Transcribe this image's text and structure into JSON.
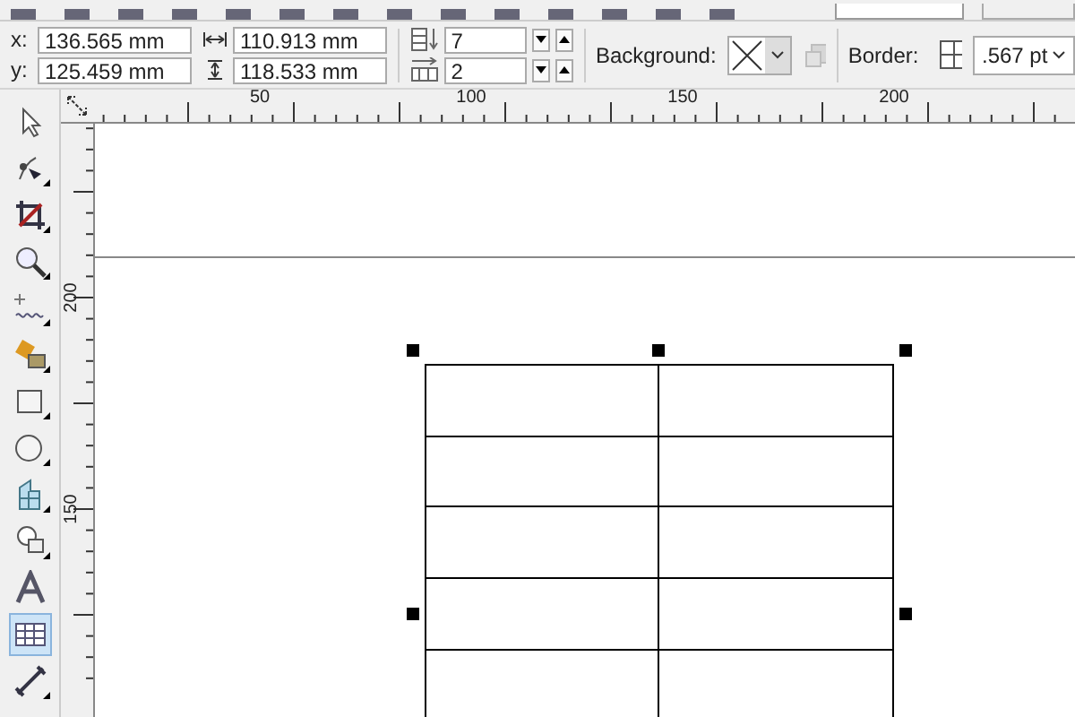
{
  "position": {
    "x_label": "x:",
    "x": "136.565 mm",
    "y_label": "y:",
    "y": "125.459 mm"
  },
  "size": {
    "width": "110.913 mm",
    "height": "118.533 mm"
  },
  "table_size": {
    "rows": "7",
    "columns": "2"
  },
  "background": {
    "label": "Background:"
  },
  "border": {
    "label": "Border:",
    "width": ".567 pt"
  },
  "ruler_h": {
    "labels": [
      "50",
      "100",
      "150",
      "200"
    ]
  },
  "ruler_v": {
    "labels": [
      "200",
      "150"
    ]
  },
  "tools": [
    {
      "kind": "pick",
      "selected": false
    },
    {
      "kind": "shape",
      "selected": false
    },
    {
      "kind": "crop",
      "selected": false
    },
    {
      "kind": "zoom",
      "selected": false
    },
    {
      "kind": "freehand",
      "selected": false
    },
    {
      "kind": "fill",
      "selected": false
    },
    {
      "kind": "rectangle",
      "selected": false
    },
    {
      "kind": "ellipse",
      "selected": false
    },
    {
      "kind": "object",
      "selected": false
    },
    {
      "kind": "shapes",
      "selected": false
    },
    {
      "kind": "text",
      "selected": false
    },
    {
      "kind": "table",
      "selected": true
    },
    {
      "kind": "dimension",
      "selected": false
    }
  ]
}
